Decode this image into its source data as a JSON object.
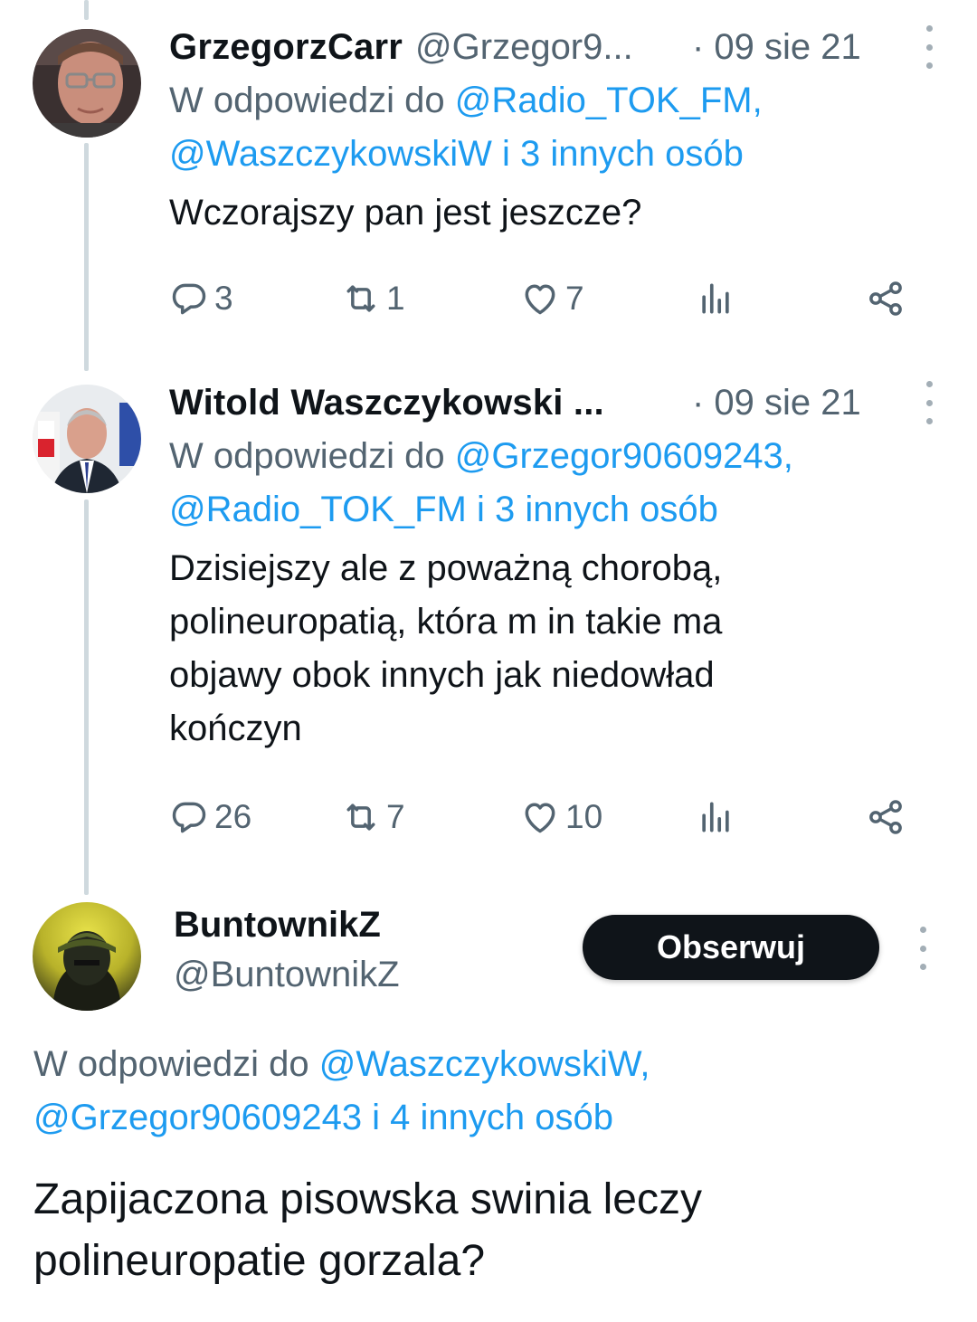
{
  "colors": {
    "text": "#0f1419",
    "secondary": "#536471",
    "link": "#1d9bf0",
    "thread_line": "#cfd9de",
    "follow_bg": "#0f1419"
  },
  "tweets": [
    {
      "name": "GrzegorzCarr",
      "handle": "@Grzegor9...",
      "date": "· 09 sie 21",
      "reply_prefix": "W odpowiedzi do ",
      "reply_mentions": "@Radio_TOK_FM,",
      "reply_mentions2": "@WaszczykowskiW i 3 innych osób",
      "text": "Wczorajszy pan jest jeszcze?",
      "replies": "3",
      "retweets": "1",
      "likes": "7",
      "avatar_icon": "man-with-glasses-avatar"
    },
    {
      "name": "Witold Waszczykowski ...",
      "date": "· 09 sie 21",
      "reply_prefix": "W odpowiedzi do ",
      "reply_mentions": "@Grzegor90609243,",
      "reply_mentions2": "@Radio_TOK_FM i 3 innych osób",
      "text_lines": [
        "Dzisiejszy ale z poważną chorobą,",
        "polineuropatią, która m in takie ma",
        "objawy obok innych jak niedowład",
        "kończyn"
      ],
      "replies": "26",
      "retweets": "7",
      "likes": "10",
      "avatar_icon": "man-in-suit-flag-avatar"
    },
    {
      "name": "BuntownikZ",
      "handle": "@BuntownikZ",
      "follow_label": "Obserwuj",
      "reply_prefix": "W odpowiedzi do ",
      "reply_mentions": "@WaszczykowskiW,",
      "reply_mentions2": "@Grzegor90609243 i 4 innych osób",
      "text_lines": [
        "Zapijaczona pisowska swinia leczy",
        "polineuropatie gorzala?"
      ],
      "avatar_icon": "helmeted-soldier-avatar"
    }
  ]
}
